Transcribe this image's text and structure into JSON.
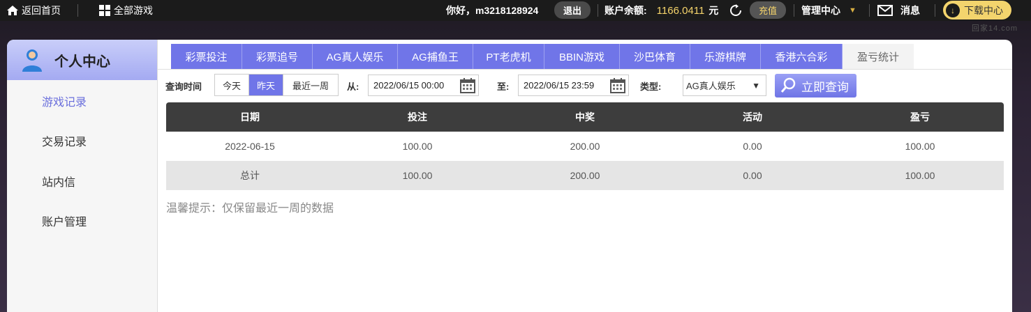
{
  "topbar": {
    "home": "返回首页",
    "all_games": "全部游戏",
    "greeting": "你好，m3218128924",
    "logout": "退出",
    "balance_label": "账户余额:",
    "balance_amount": "1166.0411",
    "balance_unit": "元",
    "recharge": "充值",
    "management": "管理中心",
    "messages": "消息",
    "download": "下载中心",
    "watermark": "回家14.com"
  },
  "sidebar": {
    "title": "个人中心",
    "items": [
      {
        "label": "游戏记录"
      },
      {
        "label": "交易记录"
      },
      {
        "label": "站内信"
      },
      {
        "label": "账户管理"
      }
    ]
  },
  "tabs": [
    {
      "label": "彩票投注"
    },
    {
      "label": "彩票追号"
    },
    {
      "label": "AG真人娱乐"
    },
    {
      "label": "AG捕鱼王"
    },
    {
      "label": "PT老虎机"
    },
    {
      "label": "BBIN游戏"
    },
    {
      "label": "沙巴体育"
    },
    {
      "label": "乐游棋牌"
    },
    {
      "label": "香港六合彩"
    },
    {
      "label": "盈亏统计"
    }
  ],
  "query": {
    "time_label": "查询时间",
    "ranges": [
      {
        "label": "今天"
      },
      {
        "label": "昨天"
      },
      {
        "label": "最近一周"
      }
    ],
    "from_label": "从:",
    "from_value": "2022/06/15 00:00",
    "to_label": "至:",
    "to_value": "2022/06/15 23:59",
    "type_label": "类型:",
    "type_value": "AG真人娱乐",
    "submit": "立即查询"
  },
  "table": {
    "headers": [
      "日期",
      "投注",
      "中奖",
      "活动",
      "盈亏"
    ],
    "rows": [
      [
        "2022-06-15",
        "100.00",
        "200.00",
        "0.00",
        "100.00"
      ]
    ],
    "total": [
      "总计",
      "100.00",
      "200.00",
      "0.00",
      "100.00"
    ]
  },
  "tip": "温馨提示：仅保留最近一周的数据",
  "colors": {
    "accent": "#7075e8",
    "gold": "#f5d46b",
    "header_dark": "#3d3d3d"
  }
}
